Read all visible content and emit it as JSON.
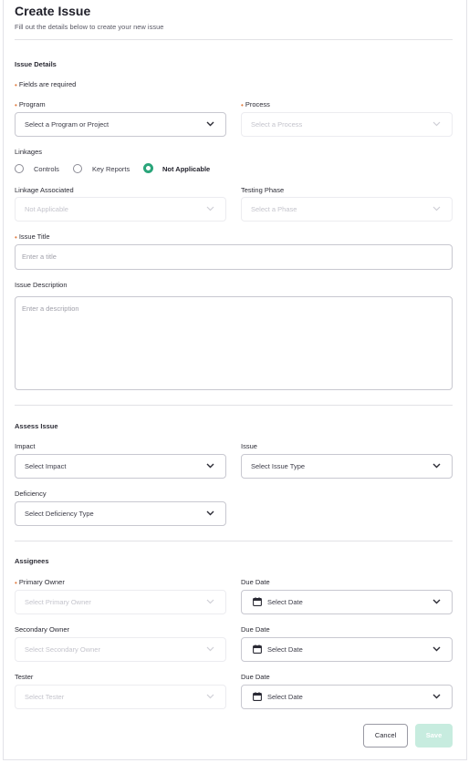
{
  "header": {
    "title": "Create Issue",
    "subtitle": "Fill out the details below to create your new issue"
  },
  "issue_details": {
    "section_title": "Issue Details",
    "required_note": "Fields are required",
    "program": {
      "label": "Program",
      "value": "Select a Program or Project"
    },
    "process": {
      "label": "Process",
      "value": "Select a Process"
    },
    "linkages": {
      "label": "Linkages",
      "options": [
        "Controls",
        "Key Reports",
        "Not Applicable"
      ],
      "selected": "Not Applicable"
    },
    "linkage_associated": {
      "label": "Linkage Associated",
      "value": "Not Applicable"
    },
    "testing_phase": {
      "label": "Testing Phase",
      "value": "Select a Phase"
    },
    "issue_title": {
      "label": "Issue Title",
      "placeholder": "Enter a title"
    },
    "issue_description": {
      "label": "Issue Description",
      "placeholder": "Enter a description"
    }
  },
  "assess_issue": {
    "section_title": "Assess Issue",
    "impact": {
      "label": "Impact",
      "value": "Select Impact"
    },
    "issue": {
      "label": "Issue",
      "value": "Select Issue Type"
    },
    "deficiency": {
      "label": "Deficiency",
      "value": "Select Deficiency Type"
    }
  },
  "assignees": {
    "section_title": "Assignees",
    "primary_owner": {
      "label": "Primary Owner",
      "value": "Select Primary Owner"
    },
    "secondary_owner": {
      "label": "Secondary Owner",
      "value": "Select Secondary Owner"
    },
    "tester": {
      "label": "Tester",
      "value": "Select Tester"
    },
    "due_date_label": "Due Date",
    "due_date_value": "Select Date"
  },
  "footer": {
    "cancel_label": "Cancel",
    "save_label": "Save"
  },
  "colors": {
    "accent": "#2aa57a",
    "required": "#e07b3f",
    "save_disabled": "#c7ecdf"
  }
}
